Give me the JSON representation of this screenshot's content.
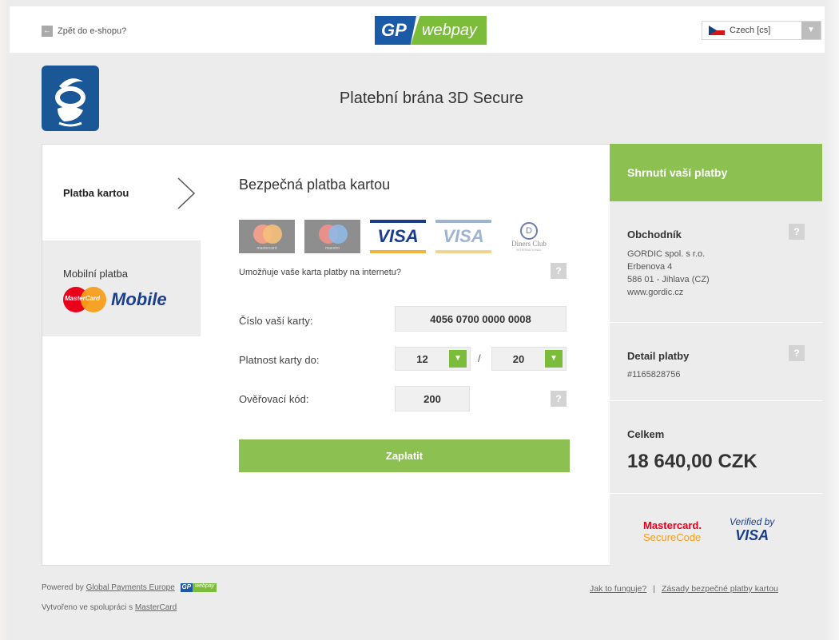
{
  "topbar": {
    "back_label": "Zpět do e-shopu?",
    "logo": {
      "gp": "GP",
      "webpay": "webpay"
    },
    "language": {
      "selected": "Czech [cs]"
    }
  },
  "header": {
    "title": "Platební brána 3D Secure"
  },
  "nav": {
    "card": "Platba kartou",
    "mobile": "Mobilní platba",
    "mobile_brand": "Mobile",
    "mobile_mc": "MasterCard"
  },
  "form": {
    "title": "Bezpečná platba kartou",
    "internet_question": "Umožňuje vaše karta platby na internetu?",
    "card_logos": {
      "mc1": "mastercard",
      "mc2": "maestro",
      "visa": "VISA",
      "visa_e": "VISA",
      "diners": "Diners Club",
      "diners_small": "INTERNATIONAL"
    },
    "card_number_label": "Číslo vaší karty:",
    "card_number_value": "4056 0700 0000 0008",
    "expiry_label": "Platnost karty do:",
    "expiry_month": "12",
    "expiry_year": "20",
    "expiry_sep": "/",
    "cvc_label": "Ověřovací kód:",
    "cvc_value": "200",
    "pay_button": "Zaplatit",
    "help_glyph": "?"
  },
  "summary": {
    "title": "Shrnutí vaší platby",
    "merchant_title": "Obchodník",
    "merchant_lines": [
      "GORDIC spol. s r.o.",
      "Erbenova 4",
      "586 01 - Jihlava (CZ)",
      "www.gordic.cz"
    ],
    "detail_title": "Detail platby",
    "detail_id": "#1165828756",
    "total_title": "Celkem",
    "total_amount": "18 640,00 CZK",
    "brand_mc_1": "Mastercard.",
    "brand_mc_2": "SecureCode",
    "brand_visa_1": "Verified by",
    "brand_visa_2": "VISA"
  },
  "footer": {
    "powered_prefix": "Powered by",
    "powered_link": "Global Payments Europe",
    "coop_prefix": "Vytvořeno ve spolupráci s",
    "coop_link": "MasterCard",
    "how_link": "Jak to funguje?",
    "sep": "|",
    "rules_link": "Zásady bezpečné platby kartou"
  },
  "colors": {
    "accent_green": "#8cc152",
    "brand_blue": "#1b5aa6",
    "merchant_blue": "#1a5797"
  }
}
